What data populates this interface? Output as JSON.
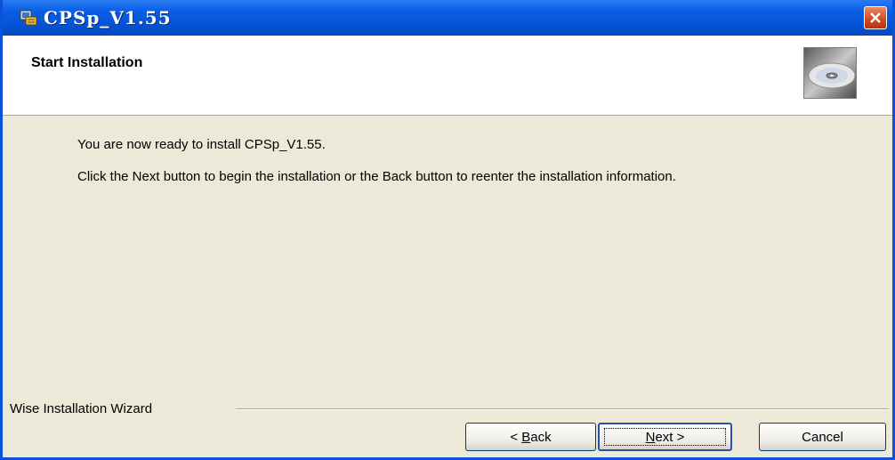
{
  "window": {
    "title": "CPSp_V1.55",
    "accent_color": "#0a53d8"
  },
  "header": {
    "title": "Start Installation",
    "icon": "cd-disc-icon"
  },
  "content": {
    "line1": "You are now ready to install CPSp_V1.55.",
    "line2": "Click the Next button to begin the installation or the Back button to reenter the installation information."
  },
  "footer": {
    "wizard_label": "Wise Installation Wizard"
  },
  "buttons": {
    "back_lt": "< ",
    "back_label": "Back",
    "next_label": "Next",
    "next_gt": " >",
    "cancel_label": "Cancel"
  }
}
